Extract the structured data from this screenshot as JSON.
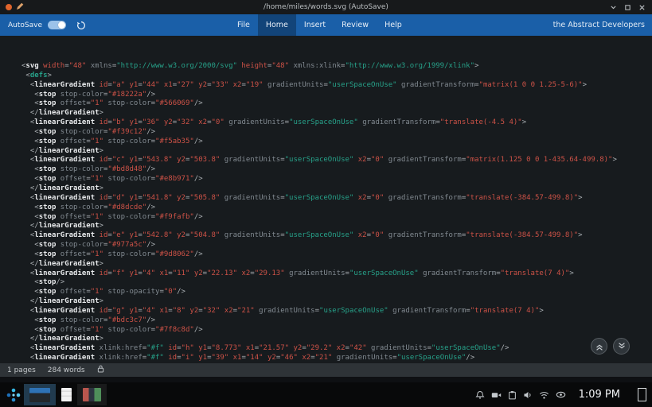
{
  "window": {
    "title": "/home/miles/words.svg (AutoSave)"
  },
  "ribbon": {
    "autosave_label": "AutoSave",
    "autosave_enabled": true,
    "tabs": [
      {
        "label": "File",
        "active": false
      },
      {
        "label": "Home",
        "active": true
      },
      {
        "label": "Insert",
        "active": false
      },
      {
        "label": "Review",
        "active": false
      },
      {
        "label": "Help",
        "active": false
      }
    ],
    "brand": "the Abstract Developers"
  },
  "editor": {
    "language": "svg-xml",
    "red_attrs": [
      "id",
      "x",
      "y",
      "x1",
      "x2",
      "y1",
      "y2",
      "width",
      "height"
    ],
    "lines": [
      "<svg width=\"48\" xmlns=\"http://www.w3.org/2000/svg\" height=\"48\" xmlns:xlink=\"http://www.w3.org/1999/xlink\">",
      " <defs>",
      "  <linearGradient id=\"a\" y1=\"44\" x1=\"27\" y2=\"33\" x2=\"19\" gradientUnits=\"userSpaceOnUse\" gradientTransform=\"matrix(1 0 0 1.25-5-6)\">",
      "   <stop stop-color=\"#18222a\"/>",
      "   <stop offset=\"1\" stop-color=\"#566069\"/>",
      "  </linearGradient>",
      "  <linearGradient id=\"b\" y1=\"36\" y2=\"32\" x2=\"0\" gradientUnits=\"userSpaceOnUse\" gradientTransform=\"translate(-4.5 4)\">",
      "   <stop stop-color=\"#f39c12\"/>",
      "   <stop offset=\"1\" stop-color=\"#f5ab35\"/>",
      "  </linearGradient>",
      "  <linearGradient id=\"c\" y1=\"543.8\" y2=\"503.8\" gradientUnits=\"userSpaceOnUse\" x2=\"0\" gradientTransform=\"matrix(1.125 0 0 1-435.64-499.8)\">",
      "   <stop stop-color=\"#bd8d48\"/>",
      "   <stop offset=\"1\" stop-color=\"#e8b971\"/>",
      "  </linearGradient>",
      "  <linearGradient id=\"d\" y1=\"541.8\" y2=\"505.8\" gradientUnits=\"userSpaceOnUse\" x2=\"0\" gradientTransform=\"translate(-384.57-499.8)\">",
      "   <stop stop-color=\"#d8dcde\"/>",
      "   <stop offset=\"1\" stop-color=\"#f9fafb\"/>",
      "  </linearGradient>",
      "  <linearGradient id=\"e\" y1=\"542.8\" y2=\"504.8\" gradientUnits=\"userSpaceOnUse\" x2=\"0\" gradientTransform=\"translate(-384.57-499.8)\">",
      "   <stop stop-color=\"#977a5c\"/>",
      "   <stop offset=\"1\" stop-color=\"#9d8062\"/>",
      "  </linearGradient>",
      "  <linearGradient id=\"f\" y1=\"4\" x1=\"11\" y2=\"22.13\" x2=\"29.13\" gradientUnits=\"userSpaceOnUse\" gradientTransform=\"translate(7 4)\">",
      "   <stop/>",
      "   <stop offset=\"1\" stop-opacity=\"0\"/>",
      "  </linearGradient>",
      "  <linearGradient id=\"g\" y1=\"4\" x1=\"8\" y2=\"32\" x2=\"21\" gradientUnits=\"userSpaceOnUse\" gradientTransform=\"translate(7 4)\">",
      "   <stop stop-color=\"#bdc3c7\"/>",
      "   <stop offset=\"1\" stop-color=\"#7f8c8d\"/>",
      "  </linearGradient>",
      "  <linearGradient xlink:href=\"#f\" id=\"h\" y1=\"8.773\" x1=\"21.57\" y2=\"29.2\" x2=\"42\" gradientUnits=\"userSpaceOnUse\"/>",
      "  <linearGradient xlink:href=\"#f\" id=\"i\" y1=\"39\" x1=\"14\" y2=\"46\" x2=\"21\" gradientUnits=\"userSpaceOnUse\"/>"
    ]
  },
  "statusbar": {
    "pages": "1 pages",
    "words": "284 words"
  },
  "taskbar": {
    "clock": "1:09 PM"
  },
  "colors": {
    "ribbon_blue": "#1a5fa8",
    "editor_bg": "#171b1e",
    "syntax_tag": "#e7e9eb",
    "syntax_red": "#cd5247",
    "syntax_teal": "#27a189",
    "syntax_gray": "#828a91"
  }
}
